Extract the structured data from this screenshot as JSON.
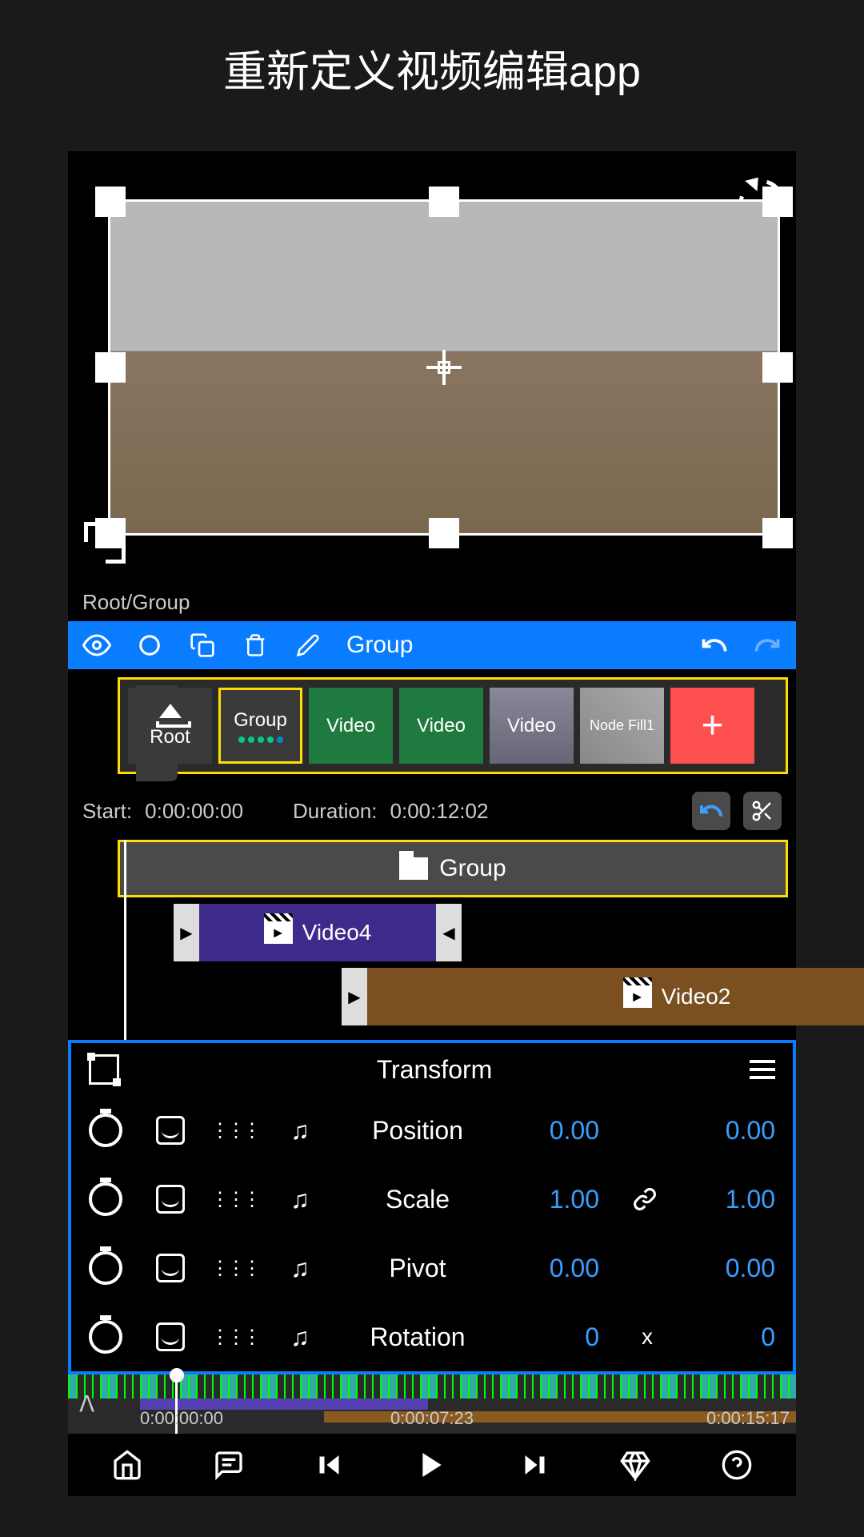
{
  "page_title": "重新定义视频编辑app",
  "breadcrumb": "Root/Group",
  "toolbar": {
    "group_label": "Group"
  },
  "nodes": {
    "root_label": "Root",
    "group_label": "Group",
    "video1": "Video",
    "video2": "Video",
    "video3": "Video",
    "nodefill": "Node Fill1",
    "add": "+"
  },
  "time": {
    "start_label": "Start:",
    "start_val": "0:00:00:00",
    "duration_label": "Duration:",
    "duration_val": "0:00:12:02"
  },
  "tracks": {
    "group": "Group",
    "video4": "Video4",
    "video2": "Video2"
  },
  "transform": {
    "title": "Transform",
    "rows": [
      {
        "name": "Position",
        "v1": "0.00",
        "link": "",
        "v2": "0.00"
      },
      {
        "name": "Scale",
        "v1": "1.00",
        "link": "link",
        "v2": "1.00"
      },
      {
        "name": "Pivot",
        "v1": "0.00",
        "link": "",
        "v2": "0.00"
      },
      {
        "name": "Rotation",
        "v1": "0",
        "link": "x",
        "v2": "0"
      }
    ]
  },
  "ruler": {
    "t1": "0:00:00:00",
    "t2": "0:00:07:23",
    "t3": "0:00:15:17"
  }
}
